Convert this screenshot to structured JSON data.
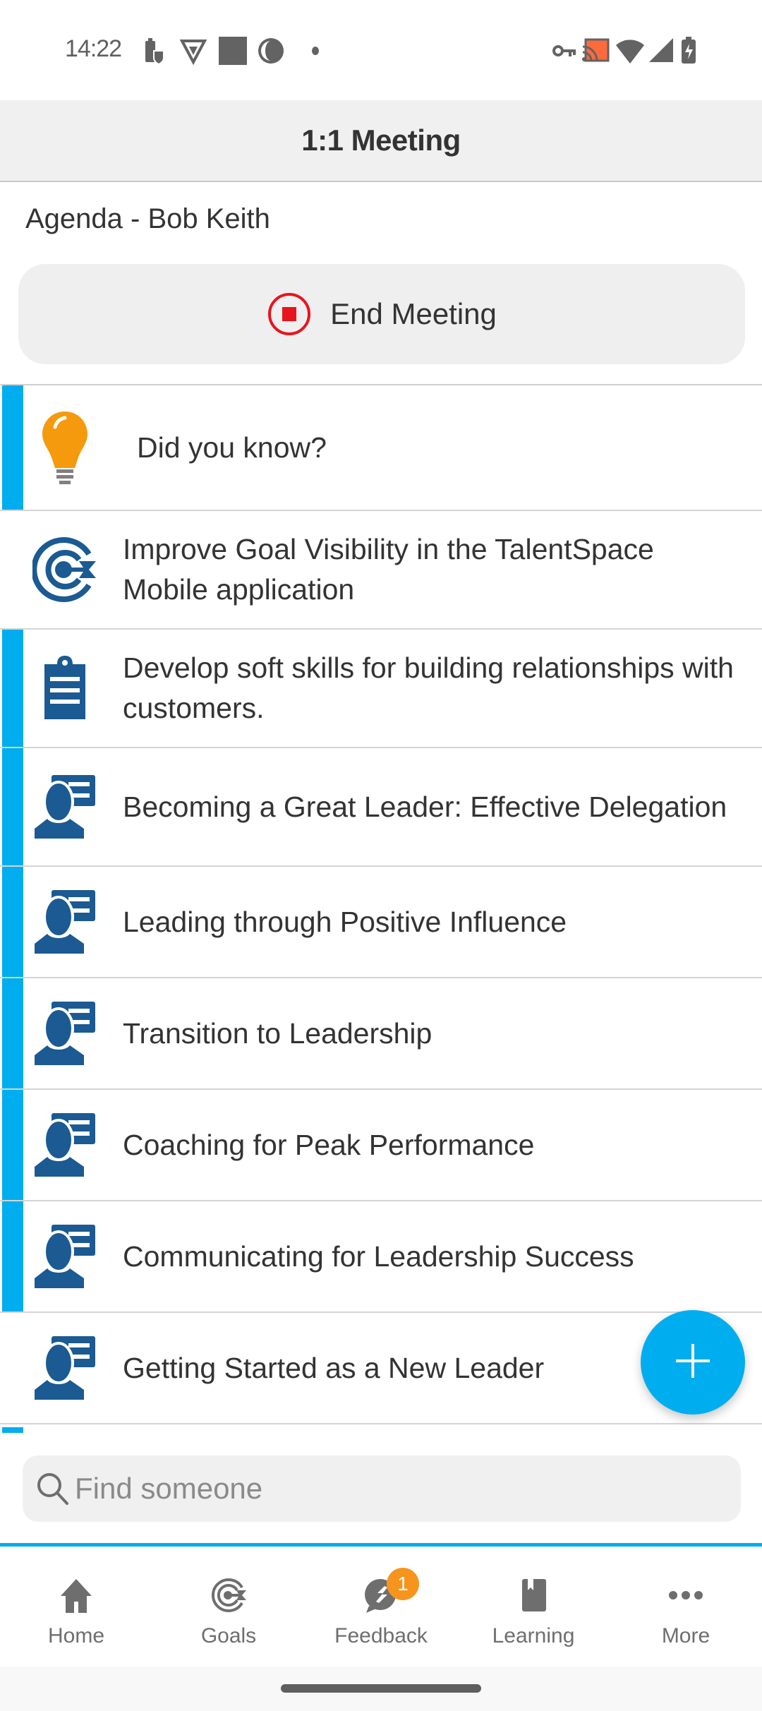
{
  "status_bar": {
    "time": "14:22",
    "left_icons": [
      "battery-saver-icon",
      "vpn-shield-icon",
      "square-app-icon",
      "aperture-app-icon",
      "more-notifications-dot"
    ],
    "right_icons": [
      "vpn-key-icon",
      "cast-icon",
      "wifi-icon",
      "cell-signal-icon",
      "battery-charging-icon"
    ]
  },
  "header": {
    "title": "1:1 Meeting"
  },
  "agenda": {
    "label": "Agenda - Bob Keith",
    "end_button_label": "End Meeting"
  },
  "items": [
    {
      "type": "tip",
      "icon": "lightbulb-icon",
      "text": "Did you know?",
      "accent": true
    },
    {
      "type": "goal",
      "icon": "goal-target-icon",
      "text": "Improve Goal Visibility in the TalentSpace Mobile application",
      "accent": false
    },
    {
      "type": "development",
      "icon": "clipboard-icon",
      "text": "Develop soft skills for building relationships with customers.",
      "accent": true
    },
    {
      "type": "learning",
      "icon": "presenter-icon",
      "text": "Becoming a Great Leader: Effective Delegation",
      "accent": true
    },
    {
      "type": "learning",
      "icon": "presenter-icon",
      "text": "Leading through Positive Influence",
      "accent": true
    },
    {
      "type": "learning",
      "icon": "presenter-icon",
      "text": "Transition to Leadership",
      "accent": true
    },
    {
      "type": "learning",
      "icon": "presenter-icon",
      "text": "Coaching for Peak Performance",
      "accent": true
    },
    {
      "type": "learning",
      "icon": "presenter-icon",
      "text": "Communicating for Leadership Success",
      "accent": true
    },
    {
      "type": "learning",
      "icon": "presenter-icon",
      "text": "Getting Started as a New Leader",
      "accent": false
    }
  ],
  "fab": {
    "icon": "plus-icon"
  },
  "search": {
    "placeholder": "Find someone",
    "value": ""
  },
  "bottom_nav": [
    {
      "label": "Home",
      "icon": "home-icon"
    },
    {
      "label": "Goals",
      "icon": "goals-icon"
    },
    {
      "label": "Feedback",
      "icon": "feedback-icon",
      "badge": "1"
    },
    {
      "label": "Learning",
      "icon": "learning-book-icon"
    },
    {
      "label": "More",
      "icon": "more-dots-icon"
    }
  ],
  "colors": {
    "accent": "#00adef",
    "icon_blue": "#1b5a92",
    "badge": "#f7941d",
    "stop_red": "#e8141e",
    "bulb": "#f59a0d"
  }
}
